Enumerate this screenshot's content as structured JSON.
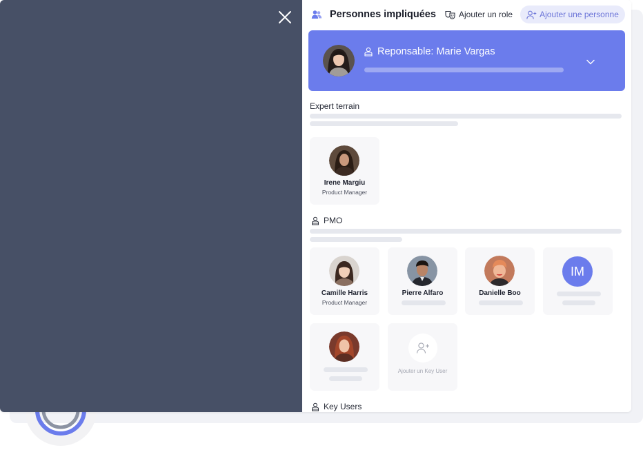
{
  "header": {
    "title": "Personnes impliquées",
    "add_role_label": "Ajouter un role",
    "add_person_label": "Ajouter une personne"
  },
  "responsible": {
    "title": "Reponsable: Marie Vargas"
  },
  "sections": {
    "expert": {
      "title": "Expert terrain"
    },
    "pmo": {
      "title": "PMO"
    },
    "key_users": {
      "title": "Key Users"
    }
  },
  "expert_people": [
    {
      "name": "Irene Margiu",
      "role": "Product Manager"
    }
  ],
  "pmo_people": [
    {
      "name": "Camille Harris",
      "role": "Product Manager"
    },
    {
      "name": "Pierre Alfaro"
    },
    {
      "name": "Danielle Boo"
    },
    {
      "initials": "IM"
    }
  ],
  "add_key_user_label": "Ajouter un Key User",
  "colors": {
    "accent": "#6b7cec",
    "overlay": "#475066",
    "accent_light": "#e9ebfb"
  },
  "icons": {
    "close": "close-icon",
    "people": "people-icon",
    "role": "masks-icon",
    "add_person": "user-plus-icon",
    "responsible": "person-badge-icon",
    "chevron": "chevron-down-icon",
    "section": "person-badge-icon"
  }
}
